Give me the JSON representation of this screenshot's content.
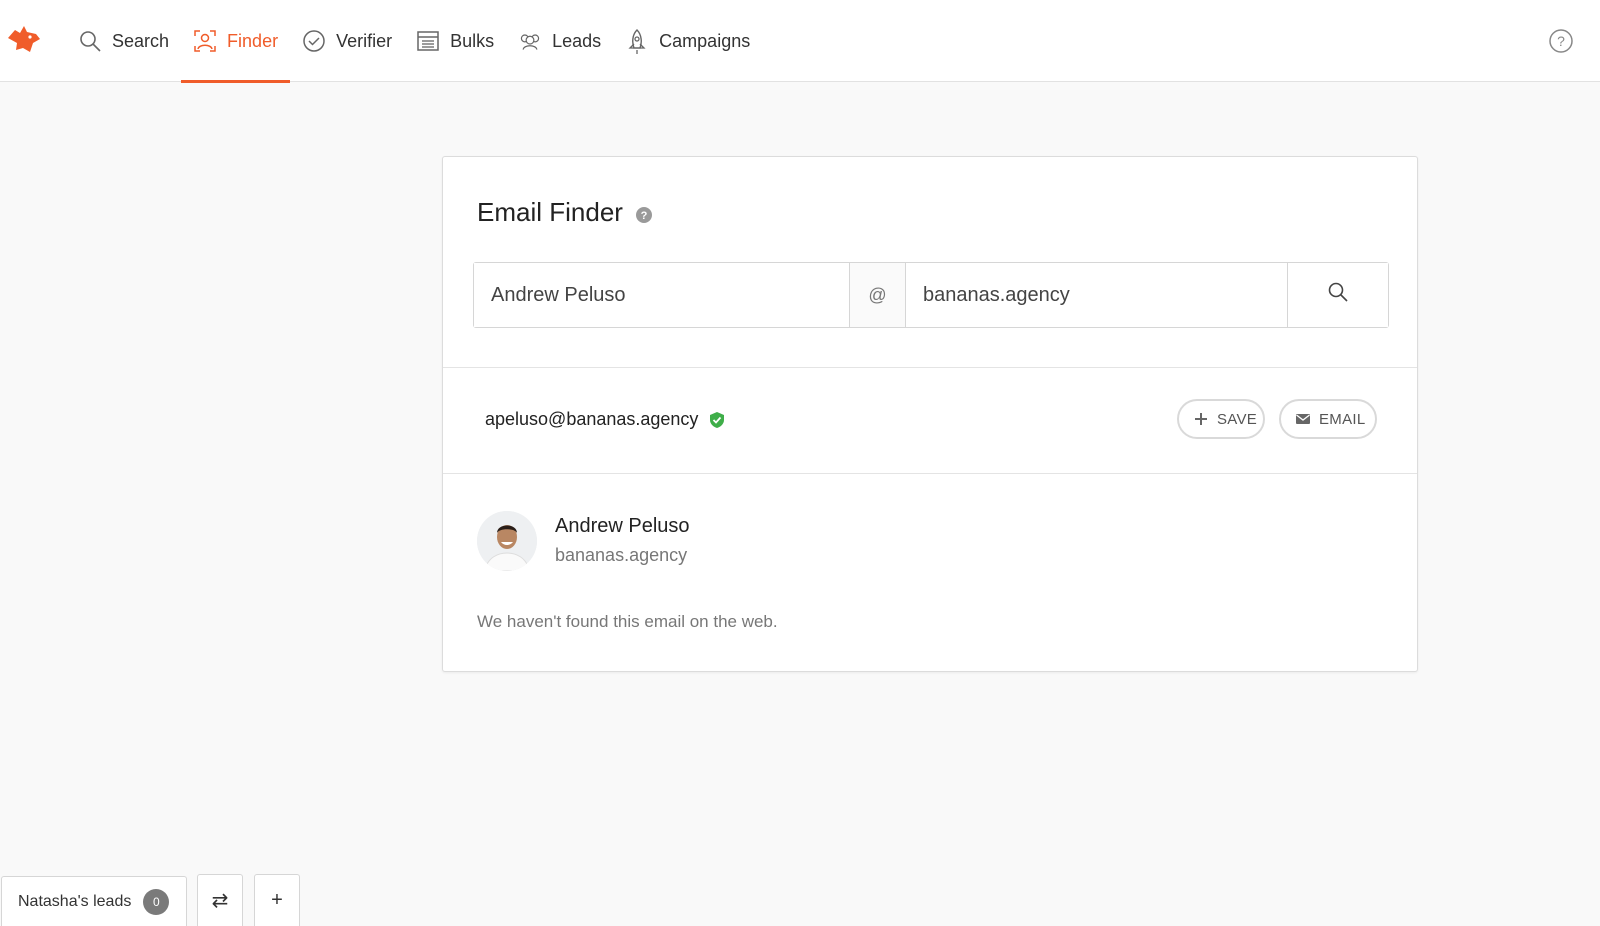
{
  "colors": {
    "accent": "#f05c2a",
    "verified": "#3fae49",
    "badge": "#7a7a7a"
  },
  "nav": {
    "logo_icon": "fox-logo-icon",
    "items": [
      {
        "label": "Search",
        "icon": "search-icon",
        "active": false
      },
      {
        "label": "Finder",
        "icon": "finder-icon",
        "active": true
      },
      {
        "label": "Verifier",
        "icon": "verifier-icon",
        "active": false
      },
      {
        "label": "Bulks",
        "icon": "bulks-icon",
        "active": false
      },
      {
        "label": "Leads",
        "icon": "leads-icon",
        "active": false
      },
      {
        "label": "Campaigns",
        "icon": "campaigns-icon",
        "active": false
      }
    ],
    "help_icon": "help-circle-icon"
  },
  "finder": {
    "title": "Email Finder",
    "name_value": "Andrew Peluso",
    "at_symbol": "@",
    "domain_value": "bananas.agency",
    "submit_icon": "search-icon"
  },
  "result": {
    "email": "apeluso@bananas.agency",
    "verified_icon": "verified-shield-icon",
    "save_label": "SAVE",
    "email_label": "EMAIL"
  },
  "person": {
    "name": "Andrew Peluso",
    "domain": "bananas.agency",
    "note": "We haven't found this email on the web."
  },
  "bottom": {
    "list_label": "Natasha's leads",
    "count": "0",
    "swap_label": "⇄",
    "add_label": "+"
  }
}
